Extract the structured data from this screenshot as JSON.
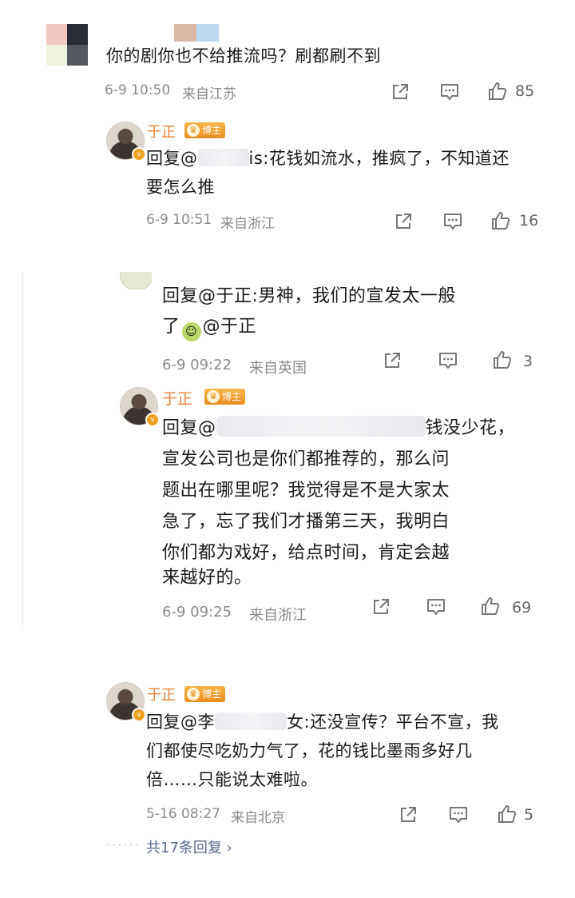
{
  "top_comment": {
    "text": "你的剧你也不给推流吗？刷都刷不到",
    "time": "6-9 10:50",
    "location": "来自江苏",
    "likes": "85"
  },
  "reply1": {
    "author": "于正",
    "badge": "博主",
    "prefix": "回复@",
    "mention_tail": "is",
    "line1_rest": ":花钱如流水，推疯了，不知道还",
    "line2": "要怎么推",
    "time": "6-9 10:51",
    "location": "来自浙江",
    "likes": "16"
  },
  "nested1": {
    "line1": "回复@于正:男神，我们的宣发太一般",
    "line2_a": "了",
    "line2_b": "@于正",
    "time": "6-9 09:22",
    "location": "来自英国",
    "likes": "3"
  },
  "nested2": {
    "author": "于正",
    "badge": "博主",
    "prefix": "回复@",
    "line1_tail": "钱没少花，",
    "line2": "宣发公司也是你们都推荐的，那么问",
    "line3": "题出在哪里呢？我觉得是不是大家太",
    "line4": "急了，忘了我们才播第三天，我明白",
    "line5": "你们都为戏好，给点时间，肯定会越",
    "line6": "来越好的。",
    "time": "6-9 09:25",
    "location": "来自浙江",
    "likes": "69"
  },
  "reply3": {
    "author": "于正",
    "badge": "博主",
    "prefix": "回复@李",
    "mention_tail": "女",
    "line1_rest": ":还没宣传？平台不宣，我",
    "line2": "们都使尽吃奶力气了，花的钱比墨雨多好几",
    "line3": "倍……只能说太难啦。",
    "time": "5-16 08:27",
    "location": "来自北京",
    "likes": "5"
  },
  "footer": {
    "more_replies": "共17条回复 ›"
  },
  "icons": [
    "share-icon",
    "comment-icon",
    "like-icon",
    "crown-icon",
    "emoji-icon"
  ],
  "colors": {
    "author_name": "#e8833a",
    "badge": "#f0a020",
    "meta_text": "#8a8a8a",
    "more_link": "#5a6b8c"
  }
}
